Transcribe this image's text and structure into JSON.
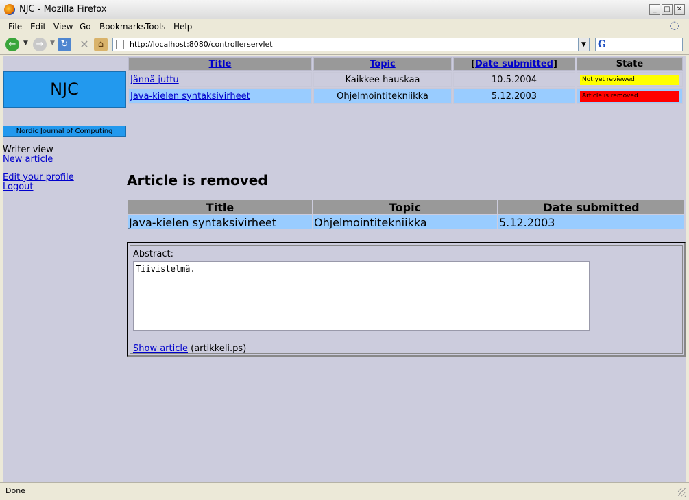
{
  "window": {
    "title": "NJC - Mozilla Firefox"
  },
  "menu": [
    "File",
    "Edit",
    "View",
    "Go",
    "Bookmarks",
    "Tools",
    "Help"
  ],
  "navbar": {
    "url": "http://localhost:8080/controllerservlet"
  },
  "status": {
    "text": "Done"
  },
  "sidebar": {
    "logo": "NJC",
    "journal": "Nordic Journal of Computing",
    "view_label": "Writer view",
    "links": {
      "new_article": "New article",
      "edit_profile": "Edit your profile",
      "logout": "Logout"
    }
  },
  "article_table": {
    "headers": {
      "title": "Title",
      "topic": "Topic",
      "date_open": "[",
      "date": "Date submitted",
      "date_close": "]",
      "state": "State"
    },
    "rows": [
      {
        "title": "Jännä juttu",
        "topic": "Kaikkee hauskaa",
        "date": "10.5.2004",
        "state": "Not yet reviewed",
        "state_color": "#ffff00"
      },
      {
        "title": "Java-kielen syntaksivirheet",
        "topic": "Ohjelmointitekniikka",
        "date": "5.12.2003",
        "state": "Article is removed",
        "state_color": "#ff0000"
      }
    ]
  },
  "detail": {
    "heading": "Article is removed",
    "headers": {
      "title": "Title",
      "topic": "Topic",
      "date": "Date submitted"
    },
    "row": {
      "title": "Java-kielen syntaksivirheet",
      "topic": "Ohjelmointitekniikka",
      "date": "5.12.2003"
    },
    "abstract_label": "Abstract:",
    "abstract_text": "Tiivistelmä.",
    "show_article": "Show article",
    "file_name": "(artikkeli.ps)"
  },
  "colors": {
    "page_bg": "#ccccdd",
    "header_bg": "#999999",
    "row_highlight": "#99ccff",
    "logo_bg": "#2299ee"
  }
}
